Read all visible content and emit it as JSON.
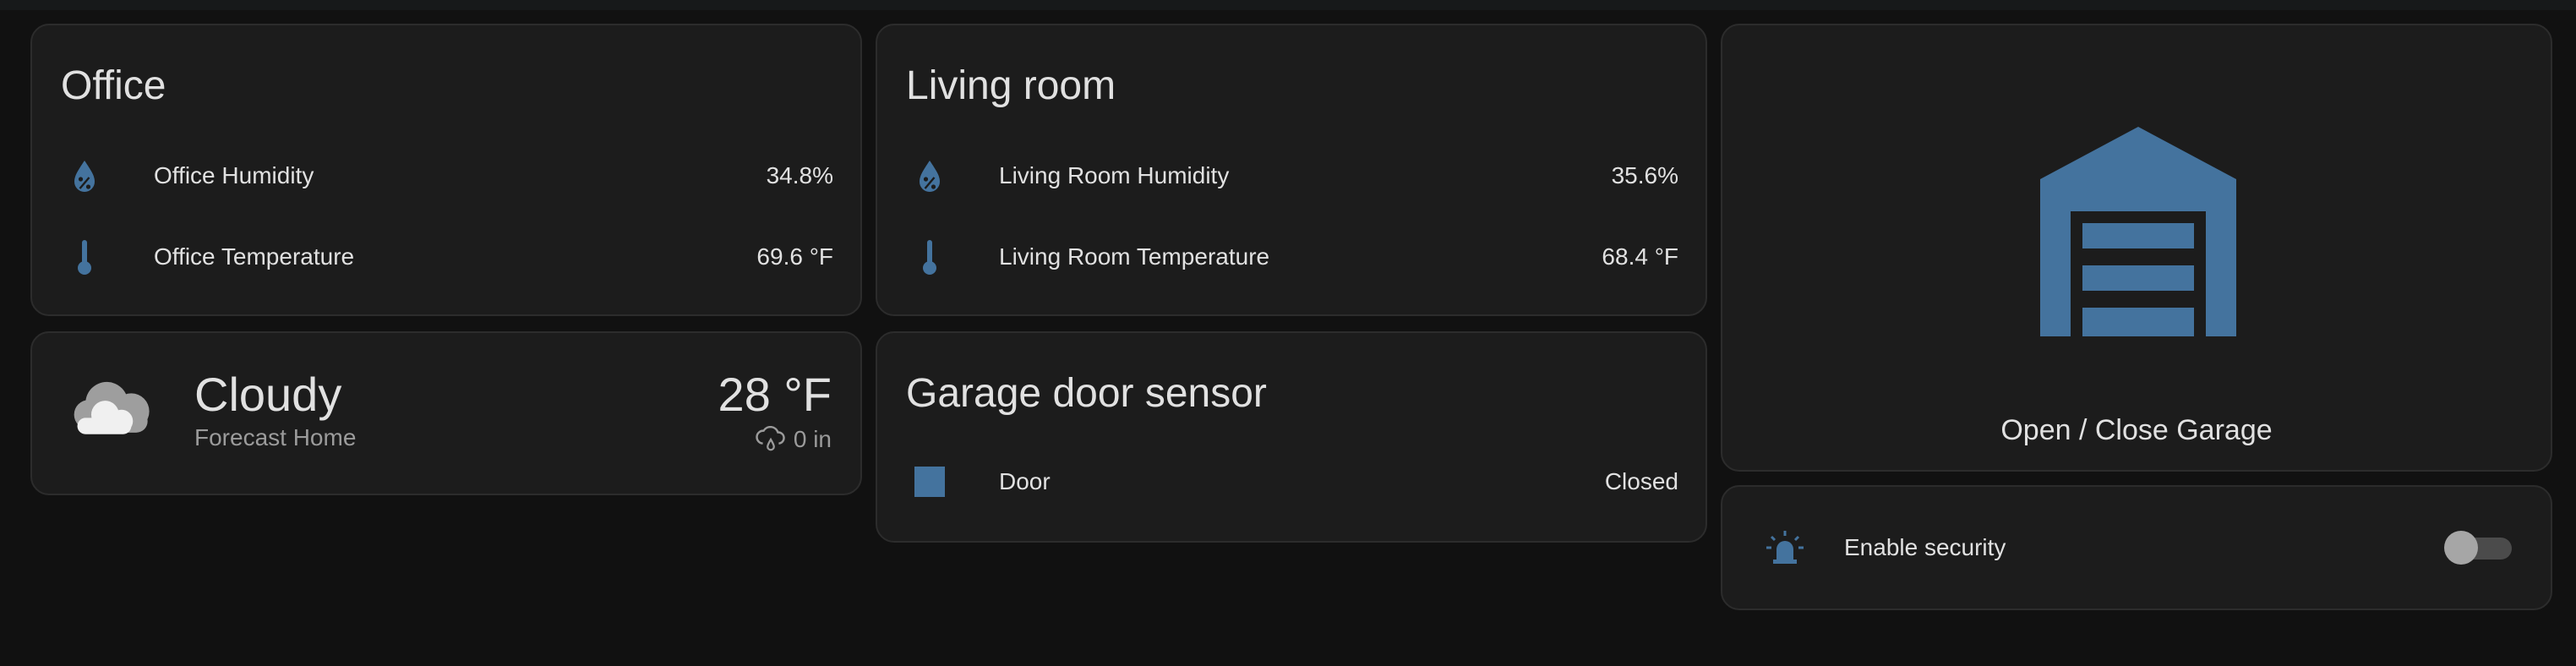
{
  "colors": {
    "background": "#111111",
    "card": "#1c1c1c",
    "card_border": "#2c2c2c",
    "accent_icon": "#44739e",
    "text_primary": "#e1e1e1",
    "text_secondary": "#9b9b9b"
  },
  "office": {
    "title": "Office",
    "rows": [
      {
        "label": "Office Humidity",
        "value": "34.8%",
        "icon": "water-percent-icon"
      },
      {
        "label": "Office Temperature",
        "value": "69.6 °F",
        "icon": "thermometer-icon"
      }
    ]
  },
  "living_room": {
    "title": "Living room",
    "rows": [
      {
        "label": "Living Room Humidity",
        "value": "35.6%",
        "icon": "water-percent-icon"
      },
      {
        "label": "Living Room Temperature",
        "value": "68.4 °F",
        "icon": "thermometer-icon"
      }
    ]
  },
  "weather": {
    "condition": "Cloudy",
    "subtitle": "Forecast Home",
    "temperature": "28 °F",
    "precipitation": "0 in",
    "icon": "cloudy-icon"
  },
  "garage_sensor": {
    "title": "Garage door sensor",
    "rows": [
      {
        "label": "Door",
        "value": "Closed",
        "icon": "square-icon"
      }
    ]
  },
  "garage_button": {
    "label": "Open / Close Garage",
    "icon": "garage-icon"
  },
  "security": {
    "label": "Enable security",
    "icon": "alarm-light-icon",
    "enabled": false
  }
}
